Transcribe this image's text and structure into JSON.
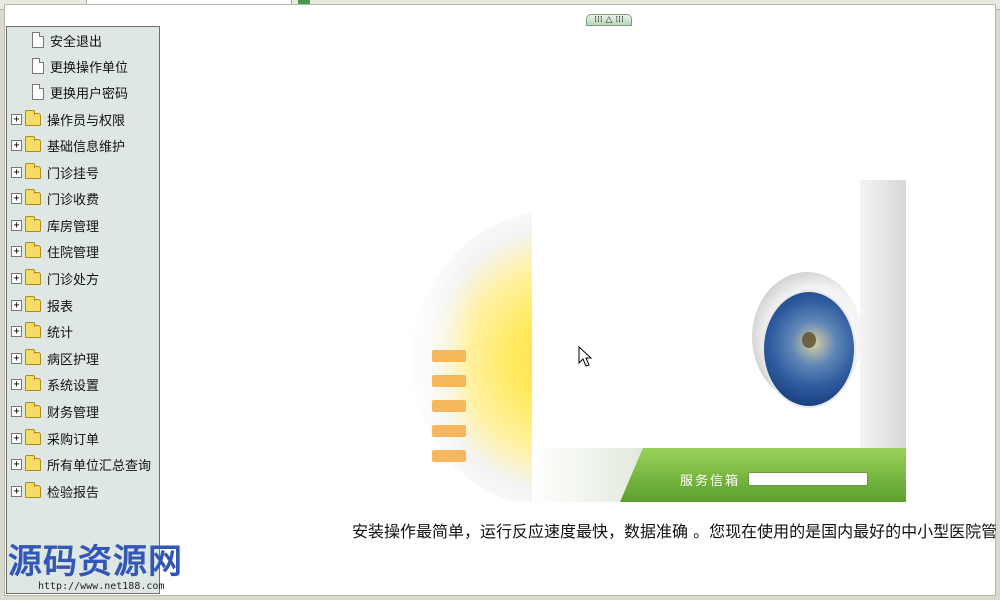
{
  "sidebar": {
    "items": [
      {
        "label": "安全退出",
        "type": "doc"
      },
      {
        "label": "更换操作单位",
        "type": "doc"
      },
      {
        "label": "更换用户密码",
        "type": "doc"
      },
      {
        "label": "操作员与权限",
        "type": "folder"
      },
      {
        "label": "基础信息维护",
        "type": "folder"
      },
      {
        "label": "门诊挂号",
        "type": "folder"
      },
      {
        "label": "门诊收费",
        "type": "folder"
      },
      {
        "label": "库房管理",
        "type": "folder"
      },
      {
        "label": "住院管理",
        "type": "folder"
      },
      {
        "label": "门诊处方",
        "type": "folder"
      },
      {
        "label": "报表",
        "type": "folder"
      },
      {
        "label": "统计",
        "type": "folder"
      },
      {
        "label": "病区护理",
        "type": "folder"
      },
      {
        "label": "系统设置",
        "type": "folder"
      },
      {
        "label": "财务管理",
        "type": "folder"
      },
      {
        "label": "采购订单",
        "type": "folder"
      },
      {
        "label": "所有单位汇总查询",
        "type": "folder"
      },
      {
        "label": "检验报告",
        "type": "folder"
      }
    ],
    "expander_symbol": "+"
  },
  "collapse_toggle": {
    "label": "⁞⁞⁞ △ ⁞⁞⁞"
  },
  "welcome": {
    "service_label": "服务信箱"
  },
  "marquee": {
    "text": "安装操作最简单，运行反应速度最快，数据准确 。您现在使用的是国内最好的中小型医院管理软件"
  },
  "watermark": {
    "title": "源码资源网",
    "url": "http://www.net188.com"
  },
  "colors": {
    "sidebar_bg": "#dfe7e4",
    "folder": "#f6dc64",
    "green_bar": "#5aa02c",
    "watermark": "#3357b6"
  }
}
